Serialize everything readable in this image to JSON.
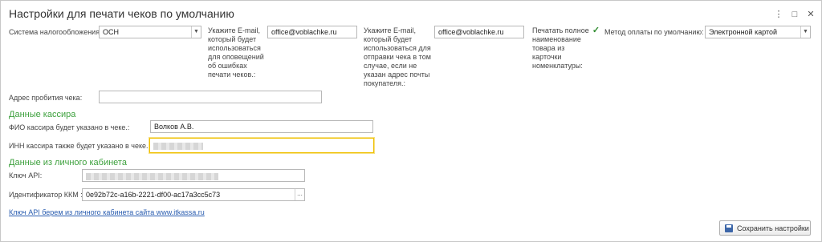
{
  "window": {
    "title": "Настройки для печати чеков по умолчанию",
    "menu_icon": "⋮",
    "maximize_icon": "□",
    "close_icon": "✕"
  },
  "tax_system": {
    "label": "Система налогообложения:",
    "value": "ОСН"
  },
  "email_notify": {
    "label": "Укажите E-mail, который будет использоваться для оповещений об ошибках печати чеков.:",
    "value": "office@voblachke.ru"
  },
  "email_receipt": {
    "label": "Укажите E-mail, который будет использоваться для отправки чека в том случае, если не указан адрес почты покупателя.:",
    "value": "office@voblachke.ru"
  },
  "print_full_name": {
    "label": "Печатать полное наименование товара из карточки номенклатуры:",
    "checked": true
  },
  "payment_method": {
    "label": "Метод оплаты по умолчанию:",
    "value": "Электронной картой"
  },
  "address": {
    "label": "Адрес пробития чека:",
    "value": ""
  },
  "cashier": {
    "section_title": "Данные кассира",
    "fio_label": "ФИО кассира будет указано в чеке.:",
    "fio_value": "Волков А.В.",
    "inn_label": "ИНН кассира также будет указано в чеке.:"
  },
  "account": {
    "section_title": "Данные из личного кабинета",
    "api_key_label": "Ключ API:",
    "kkm_label": "Идентификатор ККМ :",
    "kkm_value": "0e92b72c-a16b-2221-df00-ac17a3cc5c73",
    "link_text": "Ключ API берем из личного кабинета сайта www.itkassa.ru"
  },
  "save_button": {
    "label": "Сохранить настройки"
  }
}
